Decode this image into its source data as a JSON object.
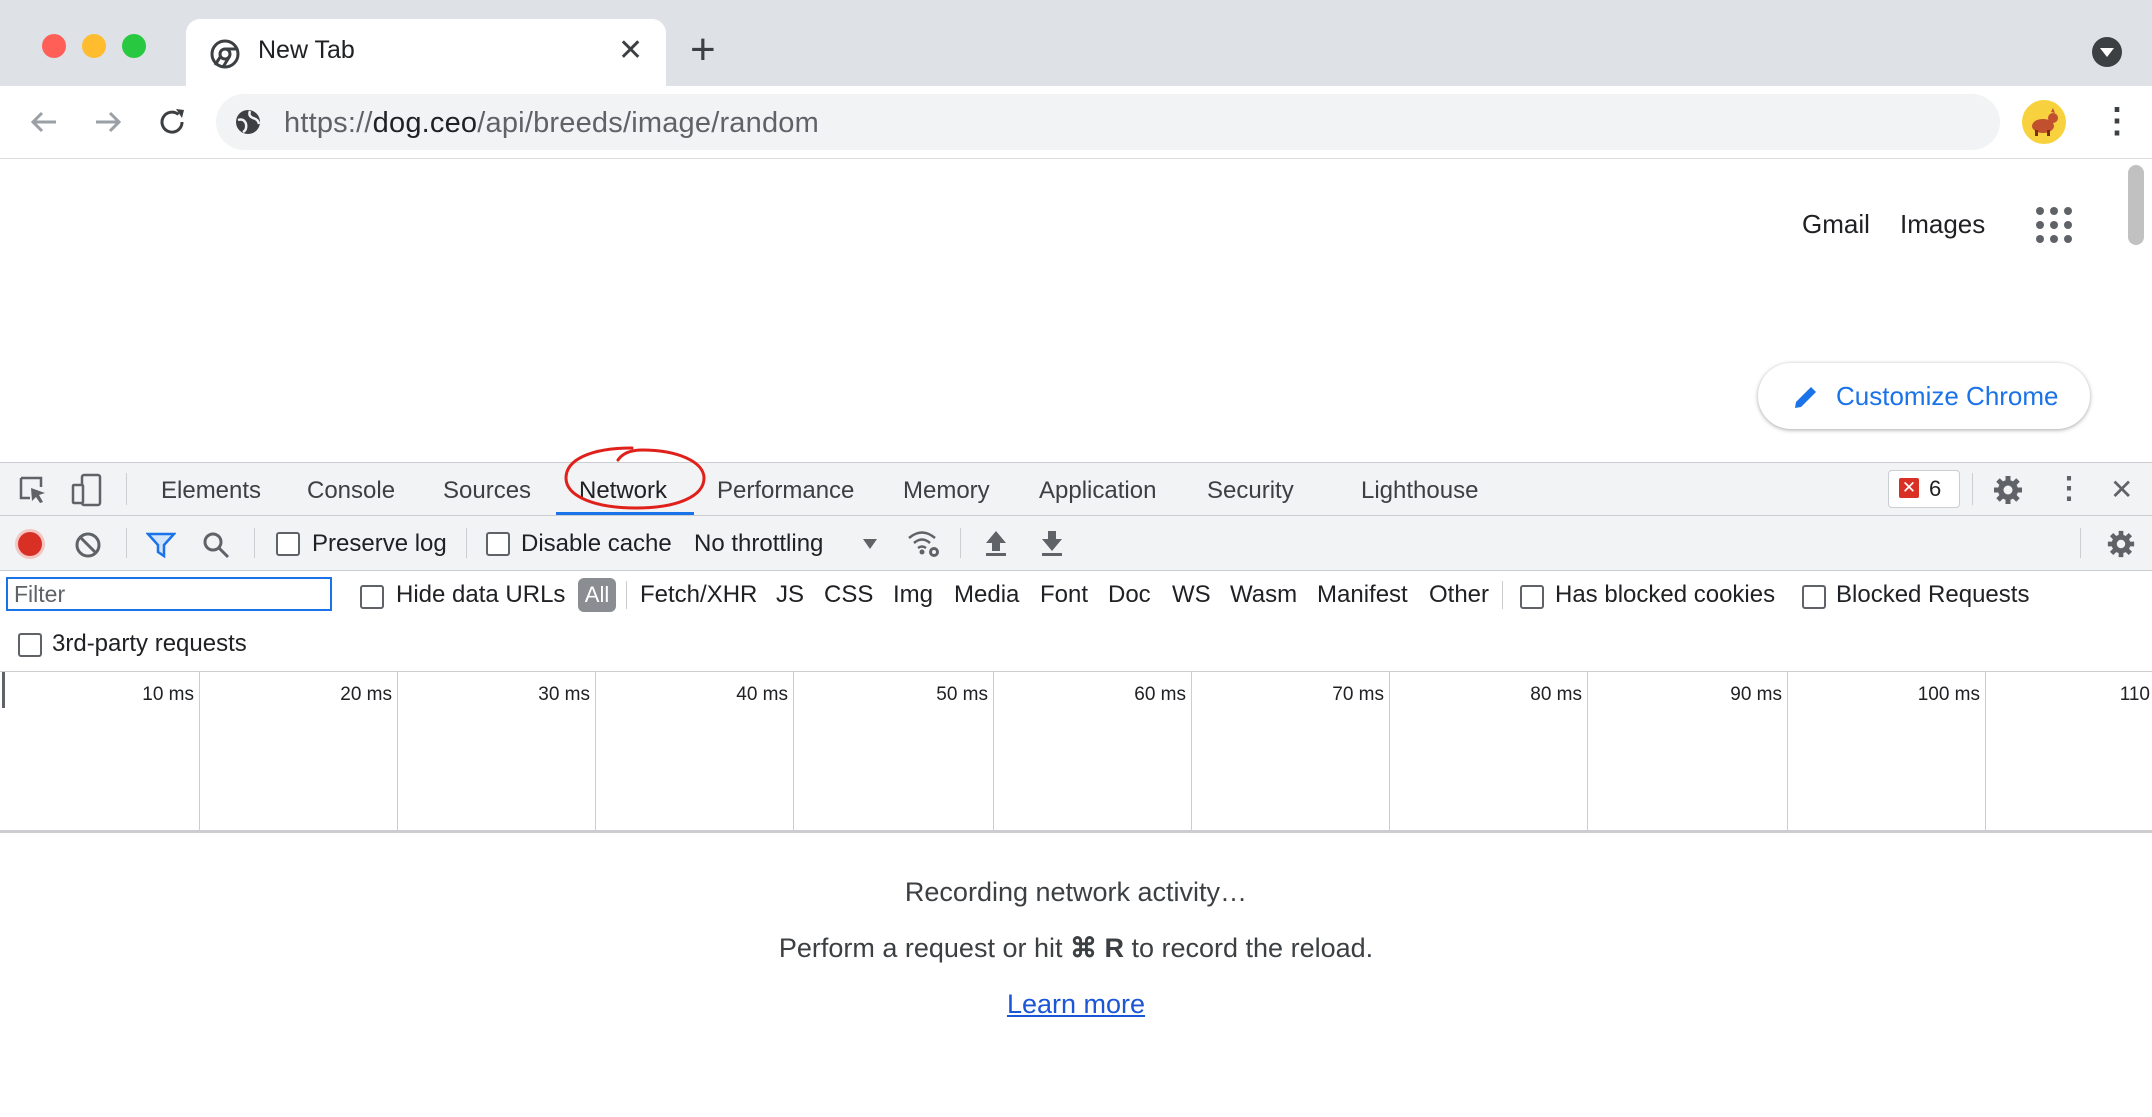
{
  "browser": {
    "tab_title": "New Tab",
    "url_prefix": "https://",
    "url_host": "dog.ceo",
    "url_path": "/api/breeds/image/random"
  },
  "page": {
    "links": [
      "Gmail",
      "Images"
    ],
    "customize_label": "Customize Chrome"
  },
  "devtools": {
    "tabs": [
      "Elements",
      "Console",
      "Sources",
      "Network",
      "Performance",
      "Memory",
      "Application",
      "Security",
      "Lighthouse"
    ],
    "active_tab": "Network",
    "error_count": "6",
    "toolbar": {
      "preserve_log": "Preserve log",
      "disable_cache": "Disable cache",
      "throttling": "No throttling"
    },
    "filter": {
      "placeholder": "Filter",
      "hide_data_urls": "Hide data URLs",
      "all": "All",
      "types": [
        "Fetch/XHR",
        "JS",
        "CSS",
        "Img",
        "Media",
        "Font",
        "Doc",
        "WS",
        "Wasm",
        "Manifest",
        "Other"
      ],
      "has_blocked_cookies": "Has blocked cookies",
      "blocked_requests": "Blocked Requests",
      "third_party": "3rd-party requests"
    },
    "timeline_ticks": [
      "10 ms",
      "20 ms",
      "30 ms",
      "40 ms",
      "50 ms",
      "60 ms",
      "70 ms",
      "80 ms",
      "90 ms",
      "100 ms",
      "110"
    ],
    "empty_state": {
      "line1": "Recording network activity…",
      "line2_prefix": "Perform a request or hit ",
      "shortcut": "⌘ R",
      "line2_suffix": " to record the reload.",
      "learn_more": "Learn more"
    }
  },
  "colors": {
    "accent": "#1a73e8",
    "record": "#d93025",
    "annotation": "#e0201b"
  }
}
